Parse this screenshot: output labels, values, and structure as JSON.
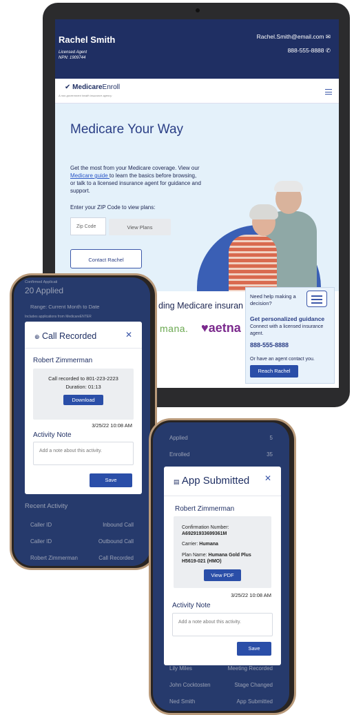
{
  "agent": {
    "name": "Rachel Smith",
    "title": "Licensed Agent",
    "npn": "NPN: 1909744",
    "email": "Rachel.Smith@email.com",
    "phone": "888-555-8888"
  },
  "brand": {
    "name_bold": "Medicare",
    "name_light": "Enroll",
    "tagline": "A non-government health insurance agency"
  },
  "hero": {
    "title": "Medicare Your Way",
    "body_1": "Get the most from your Medicare coverage. View our ",
    "link": "Medicare guide ",
    "body_2": "to learn the basics before browsing, or talk to a licensed insurance agent for guidance and support.",
    "zip_label": "Enter your ZIP Code to view plans:",
    "zip_placeholder": "Zip Code",
    "view_plans": "View Plans",
    "contact": "Contact Rachel"
  },
  "trust": {
    "text": "ding Medicare insuran",
    "logo_1": "mana.",
    "logo_2": "♥aetna"
  },
  "help": {
    "question": "Need help making a decision?",
    "title": "Get personalized guidance",
    "subtitle": "Connect with a licensed insurance agent.",
    "phone": "888-555-8888",
    "or": "Or have an agent contact you.",
    "button": "Reach Rachel"
  },
  "phone1": {
    "bg_rows": {
      "confirmed": "Confirmed Applicati",
      "applied": "20 Applied",
      "range": "Range: Current Month to Date",
      "sub": "Includes applications from MedicareENTER",
      "recent": "Recent Activity",
      "r1_left": "Caller ID",
      "r1_right": "Inbound Call",
      "r2_left": "Caller ID",
      "r2_right": "Outbound Call",
      "r3_left": "Robert Zimmerman",
      "r3_right": "Call Recorded"
    },
    "modal": {
      "title": "Call Recorded",
      "name": "Robert Zimmerman",
      "recorded": "Call recorded to 801-223-2223",
      "duration": "Duration: 01:13",
      "download": "Download",
      "date": "3/25/22 10:08 AM",
      "note_title": "Activity Note",
      "note_placeholder": "Add a note about this activity.",
      "save": "Save"
    }
  },
  "phone2": {
    "bg_rows": {
      "applied": "Applied",
      "applied_n": "5",
      "enrolled": "Enrolled",
      "enrolled_n": "35",
      "r1_left": "Lily Miles",
      "r1_right": "Meeting Recorded",
      "r2_left": "John Cocktosten",
      "r2_right": "Stage Changed",
      "r3_left": "Ned Smith",
      "r3_right": "App Submitted"
    },
    "modal": {
      "title": "App Submitted",
      "name": "Robert Zimmerman",
      "conf_label": "Confirmation Number:",
      "conf_value": "A69291933699361M",
      "carrier_label": "Carrier: ",
      "carrier_value": "Humana",
      "plan_label": "Plan Name: ",
      "plan_value": "Humana Gold Plus H5619-021 (HMO)",
      "view_pdf": "View PDF",
      "date": "3/25/22 10:08 AM",
      "note_title": "Activity Note",
      "note_placeholder": "Add a note about this activity.",
      "save": "Save"
    }
  },
  "colors": {
    "navy": "#1f2f63",
    "accent": "#2a4ea8",
    "hero_bg": "#e4f1fa"
  }
}
